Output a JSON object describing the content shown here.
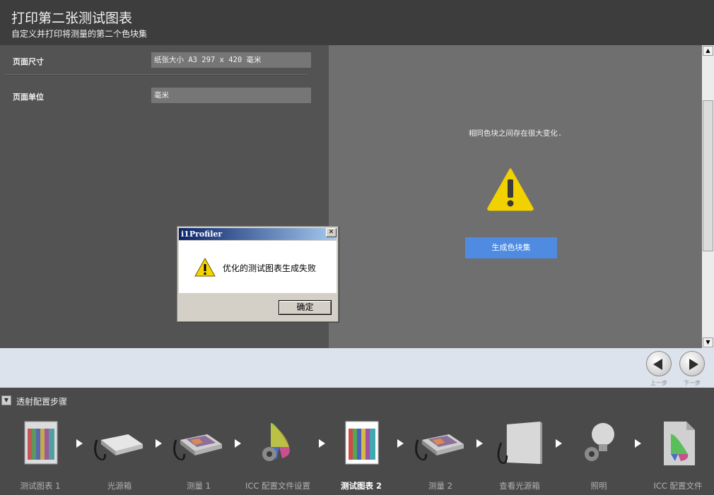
{
  "header": {
    "title": "打印第二张测试图表",
    "subtitle": "自定义并打印将测量的第二个色块集"
  },
  "left": {
    "page_size_label": "页面尺寸",
    "page_size_value": "纸张大小 A3 297 x 420 毫米",
    "page_unit_label": "页面单位",
    "page_unit_value": "毫米"
  },
  "right": {
    "message": "相同色块之间存在很大变化.",
    "generate_button": "生成色块集",
    "warning_icon": "warning-icon"
  },
  "dialog": {
    "title": "i1Profiler",
    "message": "优化的测试图表生成失败",
    "ok_label": "确定"
  },
  "nav": {
    "prev_label": "上一步",
    "next_label": "下一步"
  },
  "steps": {
    "title": "透射配置步骤",
    "items": [
      {
        "label": "测试图表 1",
        "icon": "test-chart-icon"
      },
      {
        "label": "光源箱",
        "icon": "light-box-icon"
      },
      {
        "label": "测量 1",
        "icon": "measure-device-icon"
      },
      {
        "label": "ICC 配置文件设置",
        "icon": "icc-settings-icon"
      },
      {
        "label": "测试图表 2",
        "icon": "test-chart-icon"
      },
      {
        "label": "测量 2",
        "icon": "measure-device-icon"
      },
      {
        "label": "查看光源箱",
        "icon": "view-light-box-icon"
      },
      {
        "label": "照明",
        "icon": "lighting-icon"
      },
      {
        "label": "ICC 配置文件",
        "icon": "icc-profile-icon"
      }
    ],
    "active_index": 4
  },
  "colors": {
    "accent": "#4f8be0",
    "warning": "#f2d100"
  }
}
